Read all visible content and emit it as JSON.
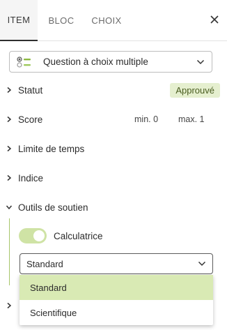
{
  "tabs": [
    {
      "label": "ITEM",
      "active": true
    },
    {
      "label": "BLOC",
      "active": false
    },
    {
      "label": "CHOIX",
      "active": false
    }
  ],
  "icons": {
    "close": "close-icon",
    "type": "multiple-choice-icon",
    "chevron_down": "chevron-down-icon",
    "chevron_right": "chevron-right-icon"
  },
  "type_select": {
    "value": "Question à choix multiple"
  },
  "sections": {
    "statut": {
      "label": "Statut",
      "badge": "Approuvé"
    },
    "score": {
      "label": "Score",
      "min": "min. 0",
      "max": "max. 1"
    },
    "limite": {
      "label": "Limite de temps"
    },
    "indice": {
      "label": "Indice"
    },
    "outils": {
      "label": "Outils de soutien",
      "expanded": true
    }
  },
  "calculatrice": {
    "toggle_label": "Calculatrice",
    "enabled": true,
    "select_value": "Standard",
    "options": [
      "Standard",
      "Scientifique"
    ],
    "selected_index": 0
  },
  "colors": {
    "accent_light": "#cfe3a5",
    "badge_bg": "#e5efcf",
    "option_selected": "#d9eab4",
    "line": "#a7c66a"
  }
}
